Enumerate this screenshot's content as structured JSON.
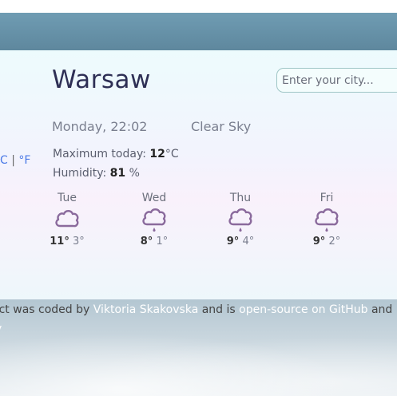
{
  "city": "Warsaw",
  "search": {
    "placeholder": "Enter your city..."
  },
  "datetime": "Monday, 22:02",
  "description": "Clear Sky",
  "units": {
    "celsius": "C",
    "separator": "|",
    "fahrenheit": "°F"
  },
  "stats": {
    "max_label": "Maximum today:",
    "max_value": "12",
    "max_unit": "°C",
    "humidity_label": "Humidity:",
    "humidity_value": "81",
    "humidity_unit": "%"
  },
  "forecast": [
    {
      "day": "Tue",
      "high": "11°",
      "low": "3°",
      "icon": "cloud-icon"
    },
    {
      "day": "Wed",
      "high": "8°",
      "low": "1°",
      "icon": "cloud-rain-icon"
    },
    {
      "day": "Thu",
      "high": "9°",
      "low": "4°",
      "icon": "cloud-rain-icon"
    },
    {
      "day": "Fri",
      "high": "9°",
      "low": "2°",
      "icon": "cloud-rain-icon"
    }
  ],
  "footer": {
    "text1": "ect was coded by ",
    "author": "Viktoria Skakovska",
    "text2": " and is ",
    "repo": "open-source on GitHub",
    "text3": " and",
    "line2": "y"
  },
  "colors": {
    "city": "#2e2f55",
    "icon": "#8a6a9c",
    "link": "#4a79e6"
  }
}
